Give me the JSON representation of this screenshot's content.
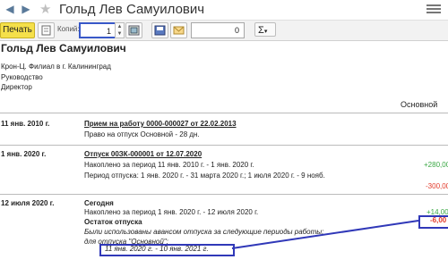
{
  "window": {
    "title": "Гольд Лев Самуилович",
    "back_icon": "arrow-left",
    "forward_icon": "arrow-right",
    "favorite_icon": "star",
    "menu_icon": "hamburger"
  },
  "toolbar": {
    "print_label": "Печать",
    "copies_label": "Копий:",
    "copies_value": "1",
    "number_value": "0",
    "sum_label": "Σ",
    "sum_caret": "▾"
  },
  "report": {
    "name": "Гольд Лев Самуилович",
    "info": [
      "Крон-Ц. Филиал в г. Калининград",
      "Руководство",
      "Директор"
    ],
    "column_header": "Основной",
    "sections": [
      {
        "date": "11 янв. 2010 г.",
        "heading": "Прием на работу 0000-000027 от 22.02.2013",
        "lines": [
          {
            "text": "Право на отпуск Основной - 28 дн.",
            "value": ""
          }
        ]
      },
      {
        "date": "1 янв. 2020 г.",
        "heading": "Отпуск 00ЗК-000001 от 12.07.2020",
        "lines": [
          {
            "text": "Накоплено за период 11 янв. 2010 г. - 1 янв. 2020 г.",
            "value": "+280,00"
          },
          {
            "text": "Период отпуска: 1 янв. 2020 г. - 31 марта 2020 г.; 1 июля 2020 г. - 9 нояб.",
            "value": "-300,00"
          }
        ]
      },
      {
        "date": "12 июля 2020 г.",
        "heading": "Сегодня",
        "lines": [
          {
            "text": "Накоплено за период 1 янв. 2020 г. - 12 июля 2020 г.",
            "value": "+14,00"
          }
        ],
        "subheading": "Остаток отпуска",
        "balance": "-6,00",
        "note1": "Были использованы авансом отпуска за следующие периоды работы:",
        "note2": "для отпуска \"Основной\":",
        "period": "11 янв. 2020 г. - 10 янв. 2021 г."
      }
    ]
  },
  "colors": {
    "print_button": "#f5e04a",
    "positive": "#3aa844",
    "negative": "#e23a2a",
    "highlight": "#3038b8"
  }
}
